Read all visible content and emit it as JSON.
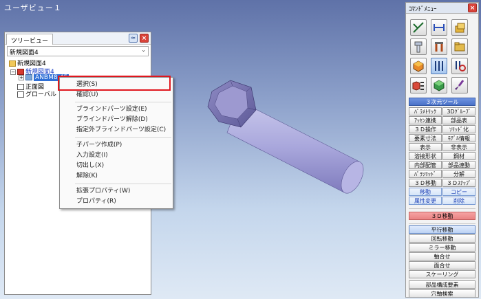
{
  "window": {
    "title": "ユーザビュー１"
  },
  "tree_panel": {
    "tab_label": "ツリービュー",
    "collapse_label": "≈",
    "close_label": "×",
    "drawing_select_value": "新規図面4",
    "nodes": [
      "新規図面4",
      "新規図面4",
      "ANBM8-45",
      "正面図",
      "グローバル"
    ]
  },
  "context_menu": {
    "items": [
      "選択(S)",
      "確認(U)",
      "ブラインドパーツ設定(E)",
      "ブラインドパーツ解除(D)",
      "指定外ブラインドパーツ設定(C)",
      "子パーツ作成(P)",
      "入力設定(I)",
      "切出し(X)",
      "解除(K)",
      "拡張プロパティ(W)",
      "プロパティ(R)"
    ]
  },
  "command_menu": {
    "title": "ｺﾏﾝﾄﾞﾒﾆｭｰ",
    "close_label": "×",
    "tool_icons": [
      "line-edit-icon",
      "dimension-icon",
      "layer-icon",
      "bolt-icon",
      "tools-icon",
      "folder-icon",
      "cube-icon",
      "parts-icon",
      "parts-search-icon",
      "cube-list-icon",
      "solid-view-icon",
      "paint-brush-icon"
    ],
    "section_3d": "３次元ツール",
    "buttons_3d": [
      [
        "ﾊﾟﾗﾒﾄﾘｯｸ",
        "3Dｸﾞﾙｰﾌﾟ"
      ],
      [
        "ｱｯｾﾝ連携",
        "部品表"
      ],
      [
        "３Ｄ操作",
        "ｿﾘｯﾄﾞ化"
      ],
      [
        "要素寸法",
        "ﾓﾃﾞﾙ情報"
      ],
      [
        "表示",
        "非表示"
      ],
      [
        "溶接形状",
        "鋼材"
      ],
      [
        "内部配管",
        "部品連動"
      ],
      [
        "ﾊﾟﾗｿﾘｯﾄﾞ",
        "分解"
      ],
      [
        "３Ｄ移動",
        "３Ｄｽﾅｯﾌﾟ"
      ]
    ],
    "mode_buttons": [
      [
        "移動",
        "コピー"
      ],
      [
        "属性変更",
        "削除"
      ]
    ],
    "section_move": "３Ｄ移動",
    "move_buttons": [
      "平行移動",
      "回転移動",
      "ミラー移動",
      "軸合せ",
      "面合せ",
      "スケーリング"
    ],
    "bottom_buttons": [
      "部品構成要素",
      "穴軸検索"
    ]
  },
  "colors": {
    "highlight_border": "#e0161d",
    "accent_blue": "#4a72c8",
    "section_red": "#e98282"
  }
}
